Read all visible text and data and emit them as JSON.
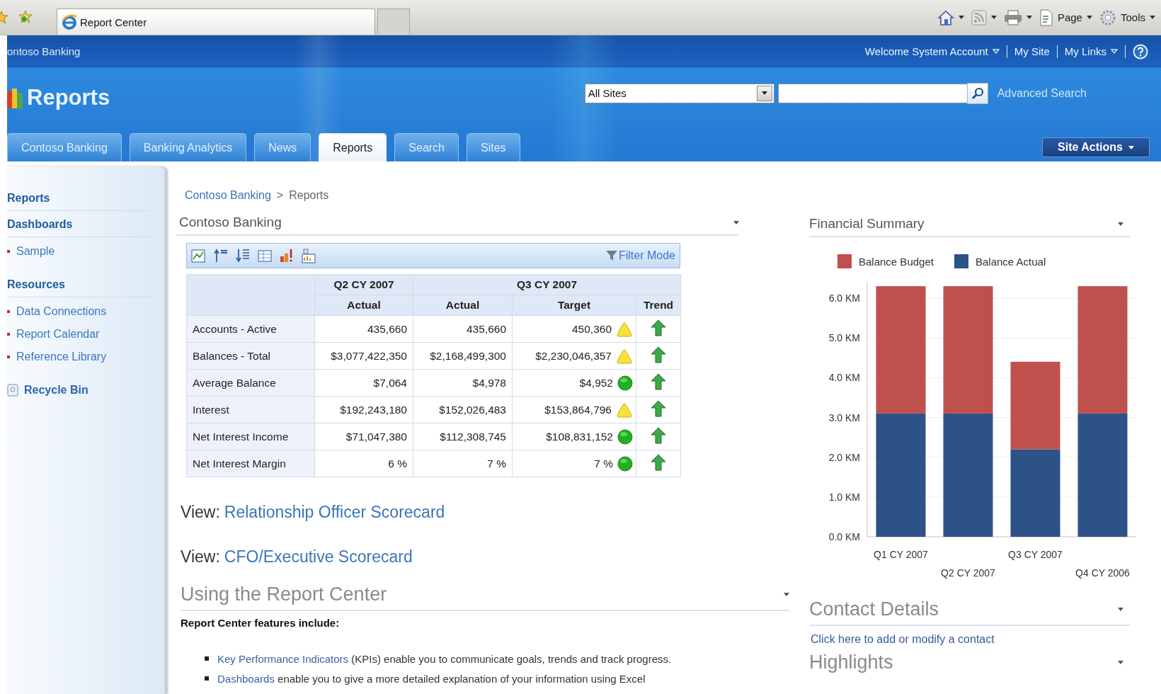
{
  "browser": {
    "tab_title": "Report Center",
    "commands": [
      "Page",
      "Tools"
    ]
  },
  "site": {
    "name": "ontoso Banking",
    "user_links": [
      {
        "label": "Welcome System Account",
        "menu": true
      },
      {
        "label": "My Site",
        "menu": false
      },
      {
        "label": "My Links",
        "menu": true
      }
    ],
    "heading": "Reports",
    "search": {
      "scope": "All Sites",
      "advanced": "Advanced Search"
    },
    "tabs": [
      {
        "label": "Contoso Banking",
        "selected": false
      },
      {
        "label": "Banking Analytics",
        "selected": false
      },
      {
        "label": "News",
        "selected": false
      },
      {
        "label": "Reports",
        "selected": true
      },
      {
        "label": "Search",
        "selected": false
      },
      {
        "label": "Sites",
        "selected": false
      }
    ],
    "site_actions": "Site Actions"
  },
  "sidebar": {
    "items": [
      {
        "kind": "heading",
        "label": "Reports"
      },
      {
        "kind": "heading",
        "label": "Dashboards"
      },
      {
        "kind": "item",
        "label": "Sample"
      },
      {
        "kind": "heading",
        "label": "Resources"
      },
      {
        "kind": "item",
        "label": "Data Connections"
      },
      {
        "kind": "item",
        "label": "Report Calendar"
      },
      {
        "kind": "item",
        "label": "Reference Library"
      },
      {
        "kind": "bin",
        "label": "Recycle Bin"
      }
    ]
  },
  "breadcrumb": {
    "link": "Contoso Banking",
    "separator": ">",
    "current": "Reports"
  },
  "scorecard": {
    "title": "Contoso Banking",
    "filter_mode": "Filter Mode",
    "groups": [
      {
        "label": "Q2 CY 2007",
        "columns": [
          "Actual"
        ]
      },
      {
        "label": "Q3 CY 2007",
        "columns": [
          "Actual",
          "Target",
          "Trend"
        ]
      }
    ],
    "rows": [
      {
        "label": "Accounts - Active",
        "values": [
          "435,660",
          "435,660",
          "450,360"
        ],
        "indicator": {
          "kind": "warning"
        },
        "trend": {
          "kind": "up"
        }
      },
      {
        "label": "Balances - Total",
        "values": [
          "$3,077,422,350",
          "$2,168,499,300",
          "$2,230,046,357"
        ],
        "indicator": {
          "kind": "warning"
        },
        "trend": {
          "kind": "up"
        }
      },
      {
        "label": "Average Balance",
        "values": [
          "$7,064",
          "$4,978",
          "$4,952"
        ],
        "indicator": {
          "kind": "good"
        },
        "trend": {
          "kind": "up"
        }
      },
      {
        "label": "Interest",
        "values": [
          "$192,243,180",
          "$152,026,483",
          "$153,864,796"
        ],
        "indicator": {
          "kind": "warning"
        },
        "trend": {
          "kind": "up"
        }
      },
      {
        "label": "Net Interest Income",
        "values": [
          "$71,047,380",
          "$112,308,745",
          "$108,831,152"
        ],
        "indicator": {
          "kind": "good"
        },
        "trend": {
          "kind": "up"
        }
      },
      {
        "label": "Net Interest Margin",
        "values": [
          "6 %",
          "7 %",
          "7 %"
        ],
        "indicator": {
          "kind": "good"
        },
        "trend": {
          "kind": "up"
        }
      }
    ]
  },
  "views": [
    {
      "label": "View:",
      "link": "Relationship Officer Scorecard"
    },
    {
      "label": "View:",
      "link": "CFO/Executive Scorecard"
    }
  ],
  "report_center": {
    "title": "Using the Report Center",
    "intro": "Report Center features include:",
    "features": [
      {
        "link": "Key Performance Indicators",
        "text": " (KPIs) enable you to communicate goals, trends and track progress."
      },
      {
        "link": "Dashboards",
        "text": " enable you to give a more detailed explanation of your information using Excel"
      }
    ]
  },
  "financial_summary": {
    "title": "Financial Summary",
    "chart_data": {
      "type": "bar",
      "stacked": true,
      "categories": [
        "Q1 CY 2007",
        "Q2 CY 2007",
        "Q3 CY 2007",
        "Q4 CY 2006"
      ],
      "series": [
        {
          "name": "Balance Budget",
          "color": "#c0504d",
          "values": [
            3.2,
            3.2,
            2.2,
            3.2
          ]
        },
        {
          "name": "Balance Actual",
          "color": "#2c5288",
          "values": [
            3.1,
            3.1,
            2.2,
            3.1
          ]
        }
      ],
      "ylim": [
        0,
        6.4
      ],
      "grid": true,
      "legend": true,
      "yticks": [
        {
          "value": 0,
          "label": "0.0 KM"
        },
        {
          "value": 1,
          "label": "1.0 KM"
        },
        {
          "value": 2,
          "label": "2.0 KM"
        },
        {
          "value": 3,
          "label": "3.0 KM"
        },
        {
          "value": 4,
          "label": "4.0 KM"
        },
        {
          "value": 5,
          "label": "5.0 KM"
        },
        {
          "value": 6,
          "label": "6.0 KM"
        }
      ]
    }
  },
  "contact_details": {
    "title": "Contact Details",
    "link": "Click here to add or modify a contact"
  },
  "highlights": {
    "title": "Highlights"
  }
}
